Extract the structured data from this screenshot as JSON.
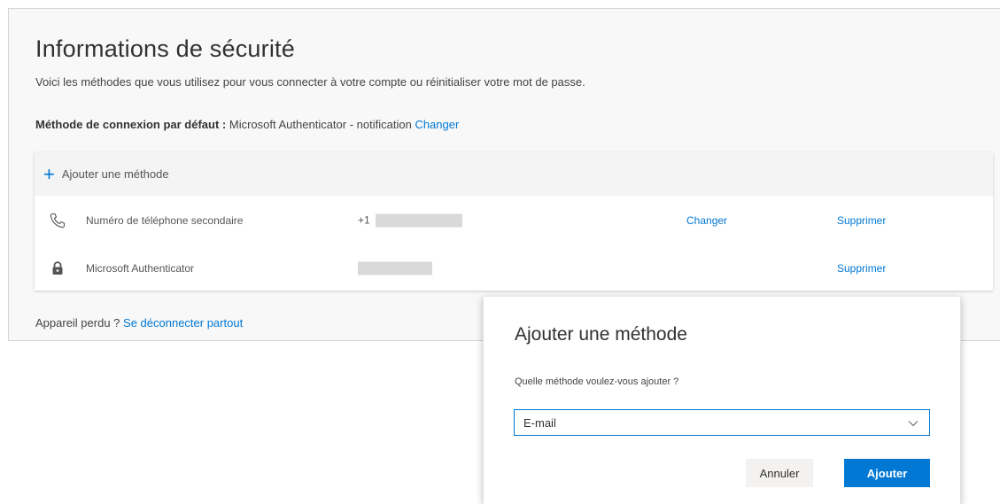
{
  "page": {
    "title": "Informations de sécurité",
    "subtitle": "Voici les méthodes que vous utilisez pour vous connecter à votre compte ou réinitialiser votre mot de passe.",
    "default_method_label": "Méthode de connexion par défaut :",
    "default_method_value": "Microsoft Authenticator - notification",
    "default_method_change": "Changer"
  },
  "methods": {
    "add_label": "Ajouter une méthode",
    "rows": [
      {
        "icon": "phone-icon",
        "label": "Numéro de téléphone secondaire",
        "value_prefix": "+1",
        "action_change": "Changer",
        "action_delete": "Supprimer"
      },
      {
        "icon": "lock-icon",
        "label": "Microsoft Authenticator",
        "value_prefix": "",
        "action_delete": "Supprimer"
      }
    ]
  },
  "footer": {
    "text": "Appareil perdu ?",
    "link": "Se déconnecter partout"
  },
  "dialog": {
    "title": "Ajouter une méthode",
    "question": "Quelle méthode voulez-vous ajouter ?",
    "selected": "E-mail",
    "cancel": "Annuler",
    "add": "Ajouter"
  },
  "colors": {
    "accent": "#0078d4",
    "panel_bg": "#f8f8f8"
  }
}
